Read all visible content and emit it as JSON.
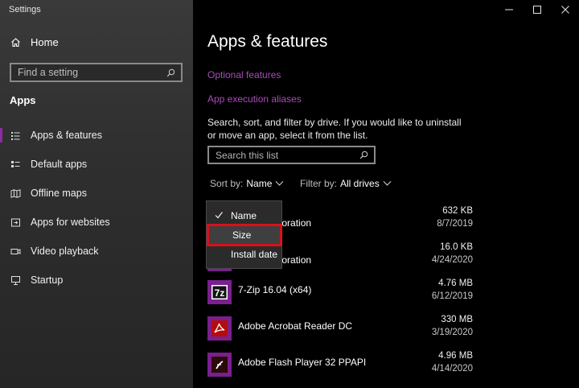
{
  "window": {
    "title": "Settings",
    "controls": [
      "—",
      "☐",
      "✕"
    ]
  },
  "sidebar": {
    "home": {
      "label": "Home",
      "icon": "home-icon"
    },
    "search": {
      "placeholder": "Find a setting",
      "icon": "search-icon"
    },
    "section": "Apps",
    "items": [
      {
        "label": "Apps & features",
        "icon": "apps-features-icon",
        "active": true
      },
      {
        "label": "Default apps",
        "icon": "default-apps-icon",
        "active": false
      },
      {
        "label": "Offline maps",
        "icon": "offline-maps-icon",
        "active": false
      },
      {
        "label": "Apps for websites",
        "icon": "apps-websites-icon",
        "active": false
      },
      {
        "label": "Video playback",
        "icon": "video-icon",
        "active": false
      },
      {
        "label": "Startup",
        "icon": "startup-icon",
        "active": false
      }
    ]
  },
  "main": {
    "title": "Apps & features",
    "links": {
      "optional": "Optional features",
      "aliases": "App execution aliases"
    },
    "description": "Search, sort, and filter by drive. If you would like to uninstall or move an app, select it from the list.",
    "list_search": {
      "placeholder": "Search this list"
    },
    "sort": {
      "label": "Sort by:",
      "value": "Name"
    },
    "filter": {
      "label": "Filter by:",
      "value": "All drives"
    },
    "apps": [
      {
        "name": "orporation",
        "size": "632 KB",
        "date": "8/7/2019",
        "icon": "app-icon"
      },
      {
        "name": "orporation",
        "size": "16.0 KB",
        "date": "4/24/2020",
        "icon": "app-icon"
      },
      {
        "name": "7-Zip 16.04 (x64)",
        "size": "4.76 MB",
        "date": "6/12/2019",
        "icon": "7zip-icon"
      },
      {
        "name": "Adobe Acrobat Reader DC",
        "size": "330 MB",
        "date": "3/19/2020",
        "icon": "acrobat-icon"
      },
      {
        "name": "Adobe Flash Player 32 PPAPI",
        "size": "4.96 MB",
        "date": "4/14/2020",
        "icon": "flash-icon"
      }
    ]
  },
  "dropdown": {
    "options": [
      {
        "label": "Name",
        "checked": true
      },
      {
        "label": "Size",
        "checked": false,
        "highlighted": true
      },
      {
        "label": "Install date",
        "checked": false
      }
    ]
  },
  "colors": {
    "accent": "#8e2ca3",
    "link": "#a84cba",
    "highlight_border": "#d9101a"
  }
}
